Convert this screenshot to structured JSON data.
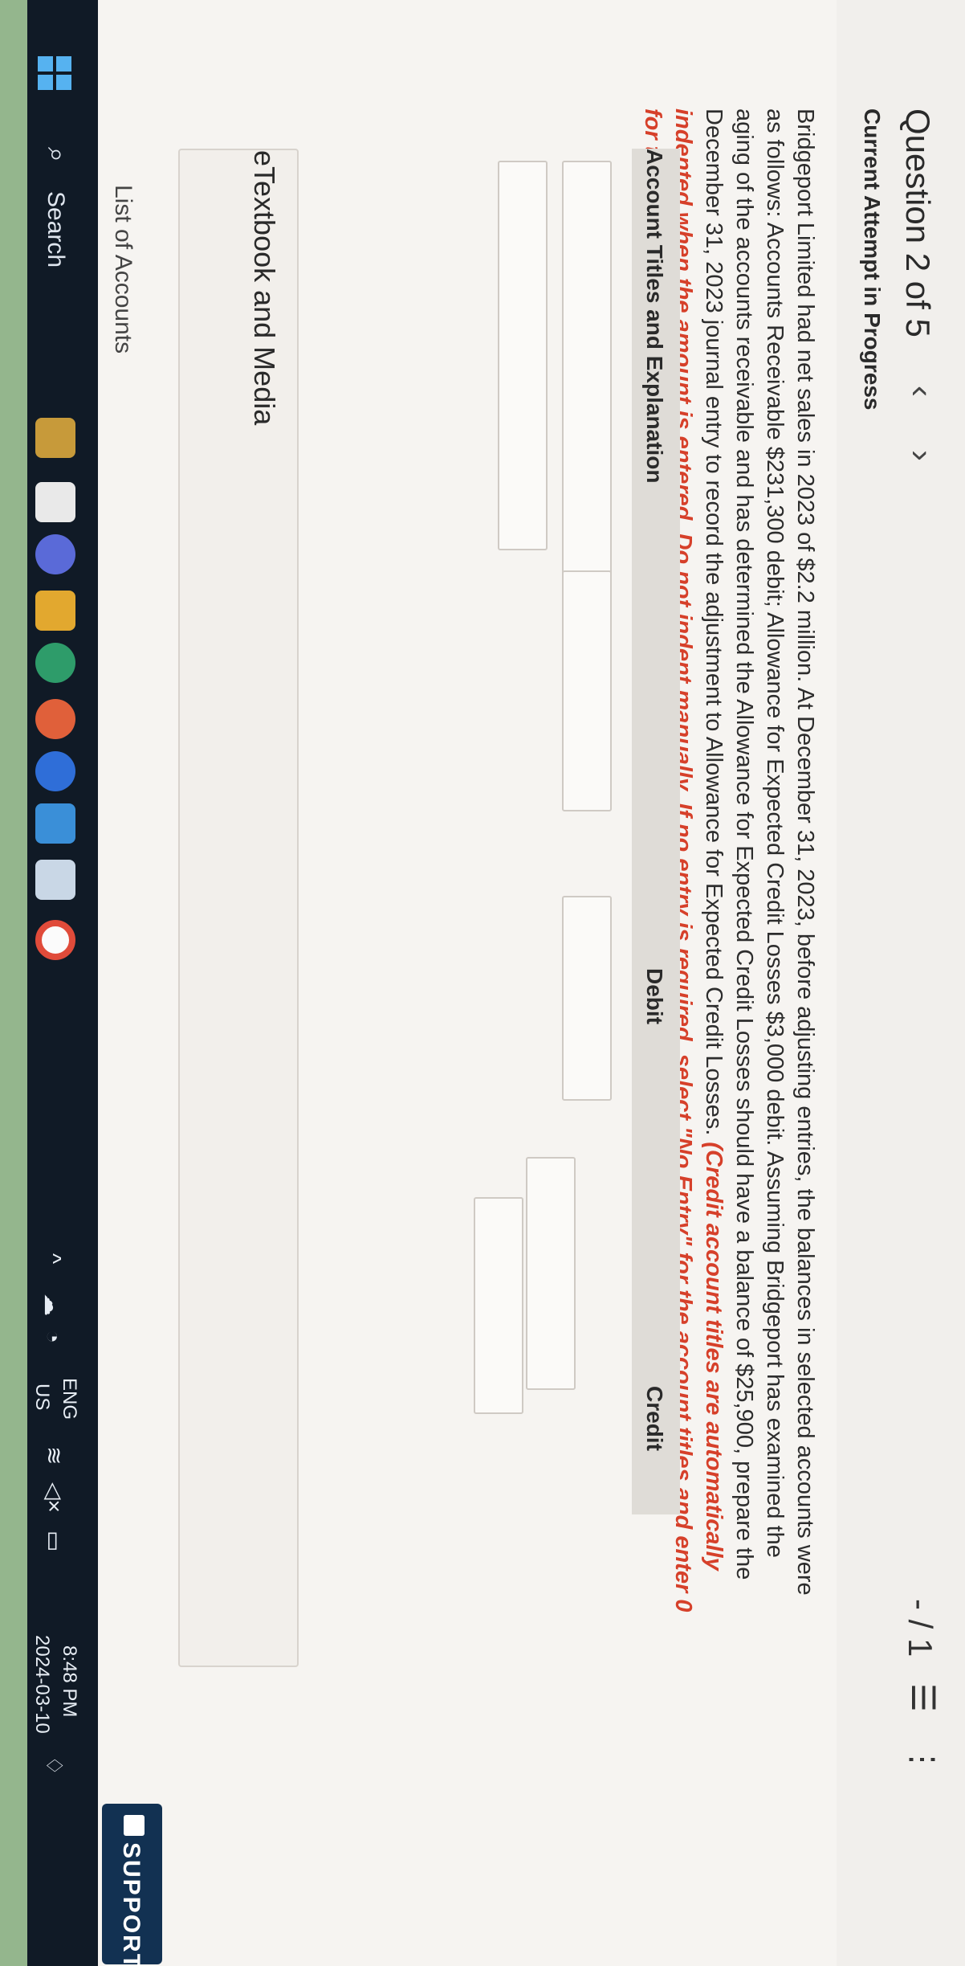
{
  "header": {
    "question_label": "Question 2 of 5",
    "prev_icon": "‹",
    "next_icon": "›",
    "page_indicator": "- / 1",
    "list_icon": "☰",
    "more_icon": "⋮"
  },
  "attempt_status": "Current Attempt in Progress",
  "question": {
    "text": "Bridgeport Limited had net sales in 2023 of $2.2 million. At December 31, 2023, before adjusting entries, the balances in selected accounts were as follows: Accounts Receivable $231,300 debit; Allowance for Expected Credit Losses $3,000 debit. Assuming Bridgeport has examined the aging of the accounts receivable and has determined the Allowance for Expected Credit Losses should have a balance of $25,900, prepare the December 31, 2023 journal entry to record the adjustment to Allowance for Expected Credit Losses.",
    "instruction": "(Credit account titles are automatically indented when the amount is entered. Do not indent manually. If no entry is required, select \"No Entry\" for the account titles and enter 0 for the amounts. List debit entry before credit entry.)"
  },
  "journal": {
    "col_account": "Account Titles and Explanation",
    "col_debit": "Debit",
    "col_credit": "Credit",
    "rows": [
      {
        "account": "",
        "debit": "",
        "credit": ""
      },
      {
        "account": "",
        "debit": "",
        "credit": ""
      }
    ]
  },
  "etextbook_label": "eTextbook and Media",
  "list_of_accounts_label": "List of Accounts",
  "support_label": "SUPPORT",
  "taskbar": {
    "search_label": "Search",
    "lang_top": "ENG",
    "lang_bottom": "US",
    "time": "8:48 PM",
    "date": "2024-03-10"
  },
  "colors": {
    "instruction_red": "#d6402a",
    "taskbar_bg": "#101a26",
    "support_bg": "#123152"
  }
}
